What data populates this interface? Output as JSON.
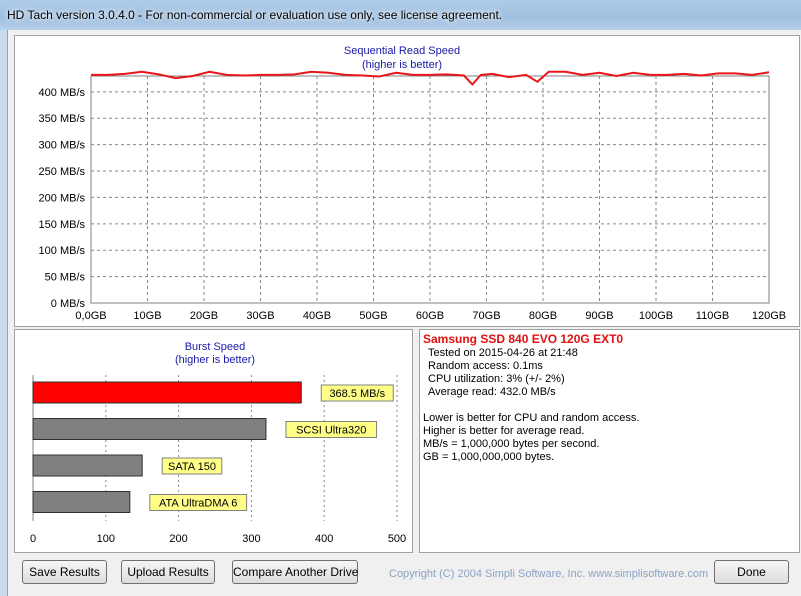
{
  "window": {
    "title": "HD Tach version 3.0.4.0  - For non-commercial or evaluation use only, see license agreement."
  },
  "seq_chart": {
    "title": "Sequential Read Speed",
    "subtitle": "(higher is better)",
    "color": "#e8161b",
    "y_ticks": [
      "0 MB/s",
      "50 MB/s",
      "100 MB/s",
      "150 MB/s",
      "200 MB/s",
      "250 MB/s",
      "300 MB/s",
      "350 MB/s",
      "400 MB/s"
    ],
    "x_ticks": [
      "0,0GB",
      "10GB",
      "20GB",
      "30GB",
      "40GB",
      "50GB",
      "60GB",
      "70GB",
      "80GB",
      "90GB",
      "100GB",
      "110GB",
      "120GB"
    ]
  },
  "burst_chart": {
    "title": "Burst Speed",
    "subtitle": "(higher is better)",
    "x_ticks": [
      "0",
      "100",
      "200",
      "300",
      "400",
      "500"
    ]
  },
  "chart_data": [
    {
      "type": "line",
      "title": "Sequential Read Speed",
      "subtitle": "(higher is better)",
      "xlabel": "",
      "ylabel": "",
      "xlim": [
        0,
        120
      ],
      "ylim": [
        0,
        430
      ],
      "x_unit": "GB",
      "y_unit": "MB/s",
      "grid": true,
      "series": [
        {
          "x": [
            0,
            3,
            6,
            9,
            12,
            15,
            18,
            21,
            24,
            27,
            30,
            33,
            36,
            39,
            42,
            45,
            48,
            51,
            54,
            57,
            60,
            63,
            66,
            67.5,
            69,
            71,
            74,
            77,
            79,
            81,
            84,
            87,
            90,
            93,
            96,
            99,
            102,
            105,
            108,
            111,
            114,
            117,
            120
          ],
          "values": [
            432,
            432,
            434,
            438,
            433,
            426,
            430,
            438,
            432,
            431,
            432,
            432,
            433,
            438,
            436,
            432,
            431,
            429,
            436,
            432,
            432,
            433,
            431,
            414,
            432,
            434,
            428,
            432,
            419,
            438,
            438,
            432,
            436,
            430,
            436,
            432,
            432,
            434,
            431,
            435,
            435,
            432,
            437
          ]
        }
      ]
    },
    {
      "type": "bar",
      "orientation": "horizontal",
      "title": "Burst Speed",
      "subtitle": "(higher is better)",
      "xlim": [
        0,
        500
      ],
      "grid": true,
      "categories": [
        "368.5 MB/s",
        "SCSI Ultra320",
        "SATA 150",
        "ATA UltraDMA 6"
      ],
      "values": [
        368.5,
        320,
        150,
        133
      ],
      "colors": [
        "#ff0000",
        "#808080",
        "#808080",
        "#808080"
      ]
    }
  ],
  "results": {
    "drive": "Samsung SSD 840 EVO 120G EXT0",
    "tested_on": "Tested on 2015-04-26 at 21:48",
    "random_access": "Random access: 0.1ms",
    "cpu": "CPU utilization: 3% (+/- 2%)",
    "avg_read": "Average read: 432.0 MB/s",
    "note1": "Lower is better for CPU and random access.",
    "note2": "Higher is better for average read.",
    "note3": "MB/s = 1,000,000 bytes per second.",
    "note4": "GB = 1,000,000,000 bytes."
  },
  "buttons": {
    "save": "Save Results",
    "upload": "Upload Results",
    "compare": "Compare Another Drive",
    "done": "Done"
  },
  "copyright": "Copyright (C) 2004 Simpli Software, Inc. www.simplisoftware.com"
}
